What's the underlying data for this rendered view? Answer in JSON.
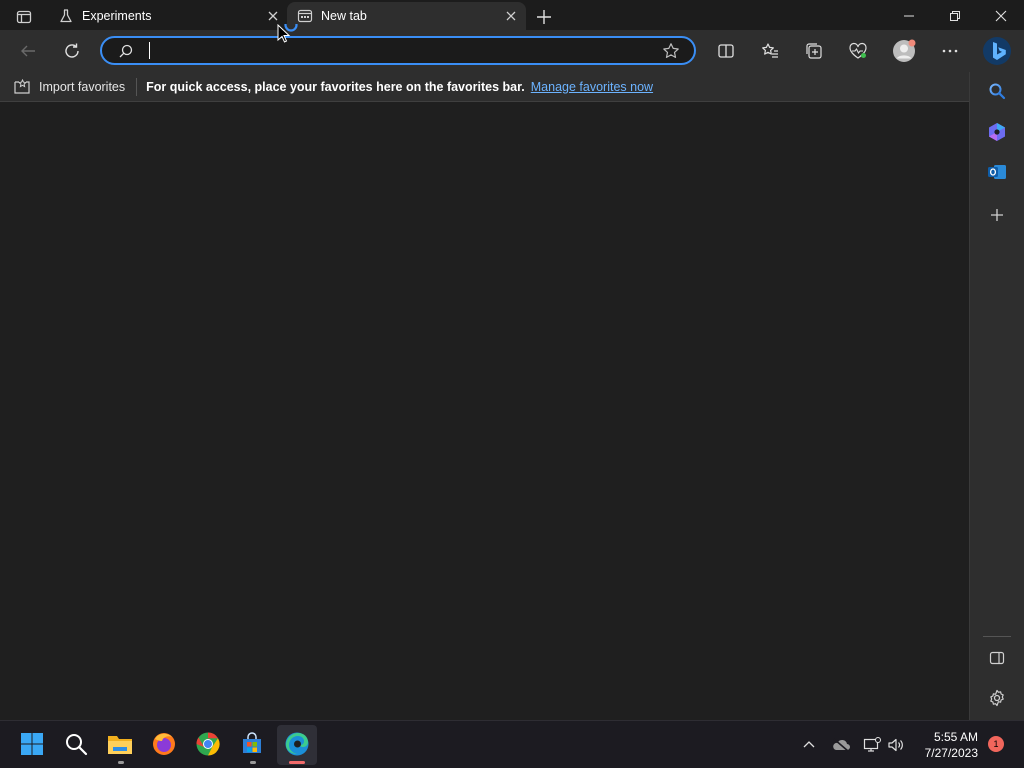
{
  "tabs": [
    {
      "title": "Experiments",
      "icon": "flask-icon"
    },
    {
      "title": "New tab",
      "icon": "newtab-page-icon",
      "active": true
    }
  ],
  "window": {
    "minimize": "minimize-icon",
    "restore": "restore-icon",
    "close": "close-icon"
  },
  "toolbar": {
    "address_value": "",
    "address_placeholder": ""
  },
  "favorites_bar": {
    "import_label": "Import favorites",
    "message": "For quick access, place your favorites here on the favorites bar.",
    "link": "Manage favorites now"
  },
  "sidebar": {
    "items": [
      "search-icon",
      "copilot-icon",
      "outlook-icon",
      "add-icon",
      "hide-sidebar-icon",
      "settings-icon"
    ]
  },
  "taskbar": {
    "apps": [
      "windows-start-icon",
      "search-icon",
      "file-explorer-icon",
      "firefox-icon",
      "chrome-icon",
      "store-icon",
      "edge-icon"
    ],
    "time": "5:55 AM",
    "date": "7/27/2023",
    "notification_count": "1"
  },
  "colors": {
    "accent": "#3a8ef5",
    "link": "#6cb3ff",
    "background": "#1f1f1f",
    "toolbar": "#2e2e2e"
  }
}
